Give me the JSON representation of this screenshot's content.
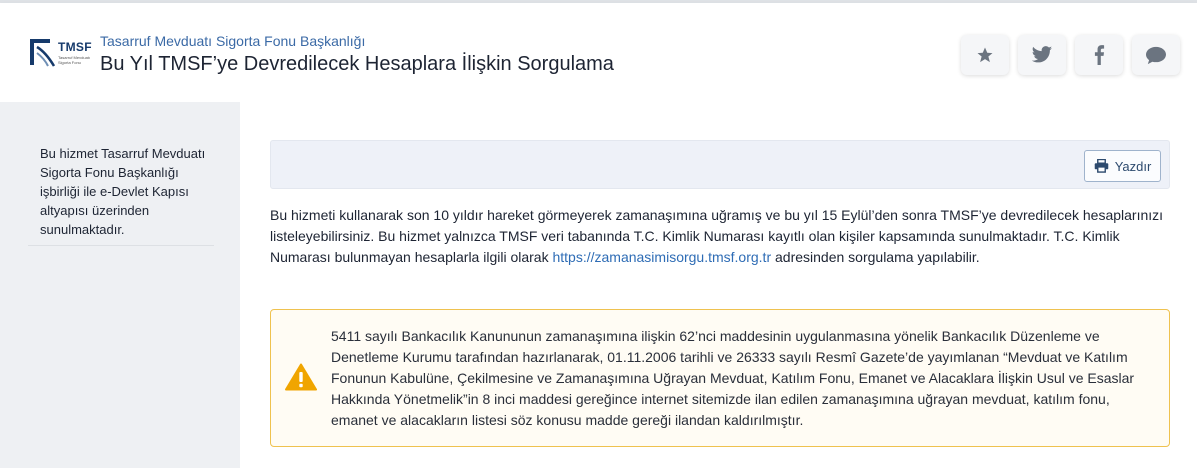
{
  "header": {
    "institution_name": "Tasarruf Mevduatı Sigorta Fonu Başkanlığı",
    "page_title": "Bu Yıl TMSF’ye Devredilecek Hesaplara İlişkin Sorgulama",
    "logo": {
      "text": "TMSF",
      "subtext": "Tasarruf Mevduatı Sigorta Fonu"
    },
    "share_buttons": [
      "star-icon",
      "twitter-icon",
      "facebook-icon",
      "comment-icon"
    ]
  },
  "sidebar": {
    "info_text": "Bu hizmet Tasarruf Mevduatı Sigorta Fonu Başkanlığı işbirliği ile e-Devlet Kapısı altyapısı üzerinden sunulmaktadır."
  },
  "toolbar": {
    "print_label": "Yazdır"
  },
  "description": {
    "text_before": "Bu hizmeti kullanarak son 10 yıldır hareket görmeyerek zamanaşımına uğramış ve bu yıl 15 Eylül’den sonra TMSF’ye devredilecek hesaplarınızı listeleyebilirsiniz. Bu hizmet yalnızca TMSF veri tabanında T.C. Kimlik Numarası kayıtlı olan kişiler kapsamında sunulmaktadır. T.C. Kimlik Numarası bulunmayan hesaplarla ilgili olarak ",
    "link_text": "https://zamanasimisorgu.tmsf.org.tr",
    "text_after": " adresinden sorgulama yapılabilir."
  },
  "warning": {
    "text": "5411 sayılı Bankacılık Kanununun zamanaşımına ilişkin 62’nci maddesinin uygulanmasına yönelik Bankacılık Düzenleme ve Denetleme Kurumu tarafından hazırlanarak, 01.11.2006 tarihli ve 26333 sayılı Resmî Gazete’de yayımlanan “Mevduat ve Katılım Fonunun Kabulüne, Çekilmesine ve Zamanaşımına Uğrayan Mevduat, Katılım Fonu, Emanet ve Alacaklara İlişkin Usul ve Esaslar Hakkında Yönetmelik”in 8 inci maddesi gereğince internet sitemizde ilan edilen zamanaşımına uğrayan mevduat, katılım fonu, emanet ve alacakların listesi söz konusu madde gereği ilandan kaldırılmıştır."
  },
  "colors": {
    "link": "#2e6cb5",
    "warning_border": "#efc24f",
    "warning_icon": "#f0a500",
    "icon_gray": "#6b7480"
  }
}
